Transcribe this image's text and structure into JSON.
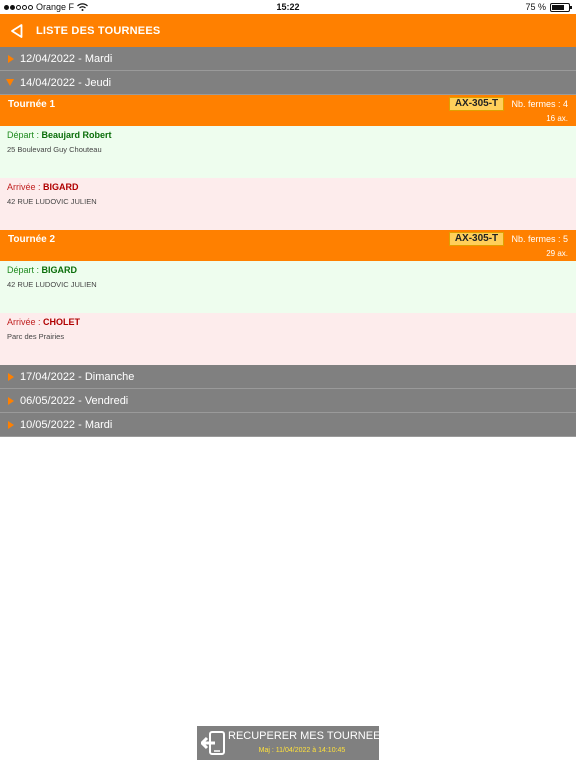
{
  "status_bar": {
    "carrier": "Orange F",
    "time": "15:22",
    "battery_text": "75 %",
    "battery_level": 0.75
  },
  "header": {
    "title": "LISTE DES TOURNEES"
  },
  "dates": [
    {
      "label": "12/04/2022 - Mardi",
      "expanded": false
    },
    {
      "label": "14/04/2022 - Jeudi",
      "expanded": true
    },
    {
      "label": "17/04/2022 - Dimanche",
      "expanded": false
    },
    {
      "label": "06/05/2022 - Vendredi",
      "expanded": false
    },
    {
      "label": "10/05/2022 - Mardi",
      "expanded": false
    }
  ],
  "tournees": [
    {
      "name": "Tournée 1",
      "plate": "AX-305-T",
      "fermes": "Nb. fermes : 4",
      "ax": "16 ax.",
      "depart": {
        "label": "Départ : ",
        "name": "Beaujard Robert",
        "address": "25 Boulevard Guy Chouteau"
      },
      "arrivee": {
        "label": "Arrivée : ",
        "name": "BIGARD",
        "address": "42 RUE LUDOVIC JULIEN"
      }
    },
    {
      "name": "Tournée 2",
      "plate": "AX-305-T",
      "fermes": "Nb. fermes : 5",
      "ax": "29 ax.",
      "depart": {
        "label": "Départ : ",
        "name": "BIGARD",
        "address": "42 RUE LUDOVIC JULIEN"
      },
      "arrivee": {
        "label": "Arrivée : ",
        "name": "CHOLET",
        "address": "Parc des Prairies"
      }
    }
  ],
  "recup_button": {
    "label": "RECUPERER MES TOURNEES",
    "maj": "Maj : 11/04/2022 à 14:10:45"
  },
  "colors": {
    "orange": "#ff8000",
    "grey": "#808080",
    "plate": "#ffcf5a",
    "depart_bg": "#eefdee",
    "arrivee_bg": "#fdecec"
  }
}
